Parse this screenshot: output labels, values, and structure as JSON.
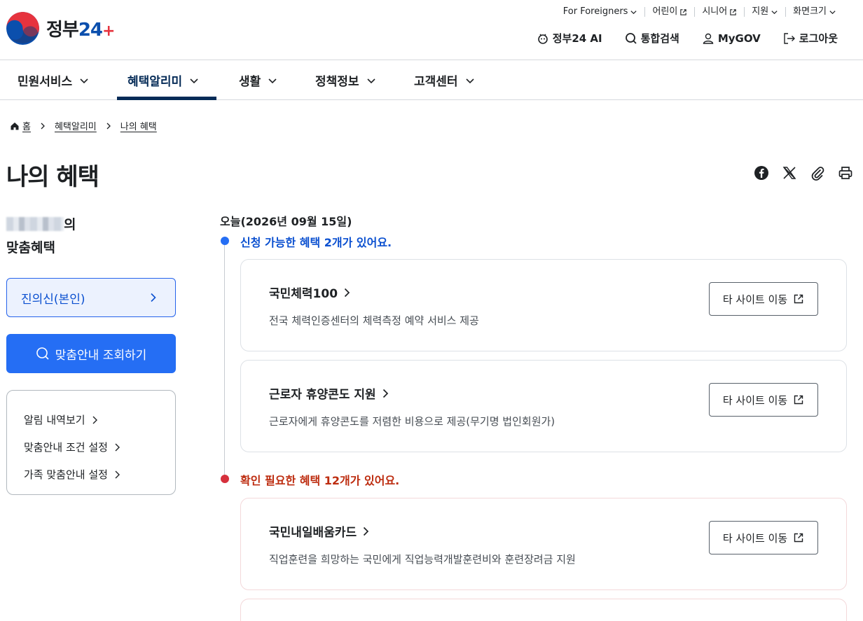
{
  "header": {
    "logo_text": "정부",
    "logo_num": "24",
    "logo_plus": "+",
    "util": [
      {
        "label": "For Foreigners",
        "icon": "chevron-down-icon"
      },
      {
        "label": "어린이",
        "icon": "external-link-icon"
      },
      {
        "label": "시니어",
        "icon": "external-link-icon"
      },
      {
        "label": "지원",
        "icon": "chevron-down-icon"
      },
      {
        "label": "화면크기",
        "icon": "chevron-down-icon"
      }
    ],
    "actions": [
      {
        "label": "정부24 AI",
        "icon": "ai-icon"
      },
      {
        "label": "통합검색",
        "icon": "search-icon"
      },
      {
        "label": "MyGOV",
        "icon": "user-icon"
      },
      {
        "label": "로그아웃",
        "icon": "logout-icon"
      }
    ]
  },
  "nav": {
    "items": [
      {
        "label": "민원서비스"
      },
      {
        "label": "혜택알리미"
      },
      {
        "label": "생활"
      },
      {
        "label": "정책정보"
      },
      {
        "label": "고객센터"
      }
    ],
    "active_index": 1
  },
  "breadcrumb": [
    "홈",
    "혜택알리미",
    "나의 혜택"
  ],
  "page_title": "나의 혜택",
  "share_icons": [
    "facebook-icon",
    "x-icon",
    "link-icon",
    "print-icon"
  ],
  "sidebar": {
    "user_suffix": "의",
    "user_sub": "맞춤혜택",
    "profile_label": "진의신(본인)",
    "search_label": "맞춤안내 조회하기",
    "links": [
      "알림 내역보기",
      "맞춤안내 조건 설정",
      "가족 맞춤안내 설정"
    ]
  },
  "main": {
    "today": "오늘(2026년 09월 15일)",
    "sections": [
      {
        "title": "신청 가능한 혜택 2개가 있어요.",
        "color": "#0b50d0",
        "cards": [
          {
            "title": "국민체력100",
            "desc": "전국 체력인증센터의 체력측정 예약 서비스 제공",
            "button": "타 사이트 이동"
          },
          {
            "title": "근로자 휴양콘도 지원",
            "desc": "근로자에게 휴양콘도를 저렴한 비용으로 제공(무기명 법인회원가)",
            "button": "타 사이트 이동"
          }
        ]
      },
      {
        "title": "확인 필요한 혜택 12개가 있어요.",
        "color": "#bd2c0f",
        "cards": [
          {
            "title": "국민내일배움카드",
            "desc": "직업훈련을 희망하는 국민에게 직업능력개발훈련비와 훈련장려금 지원",
            "button": "타 사이트 이동"
          }
        ]
      }
    ]
  }
}
